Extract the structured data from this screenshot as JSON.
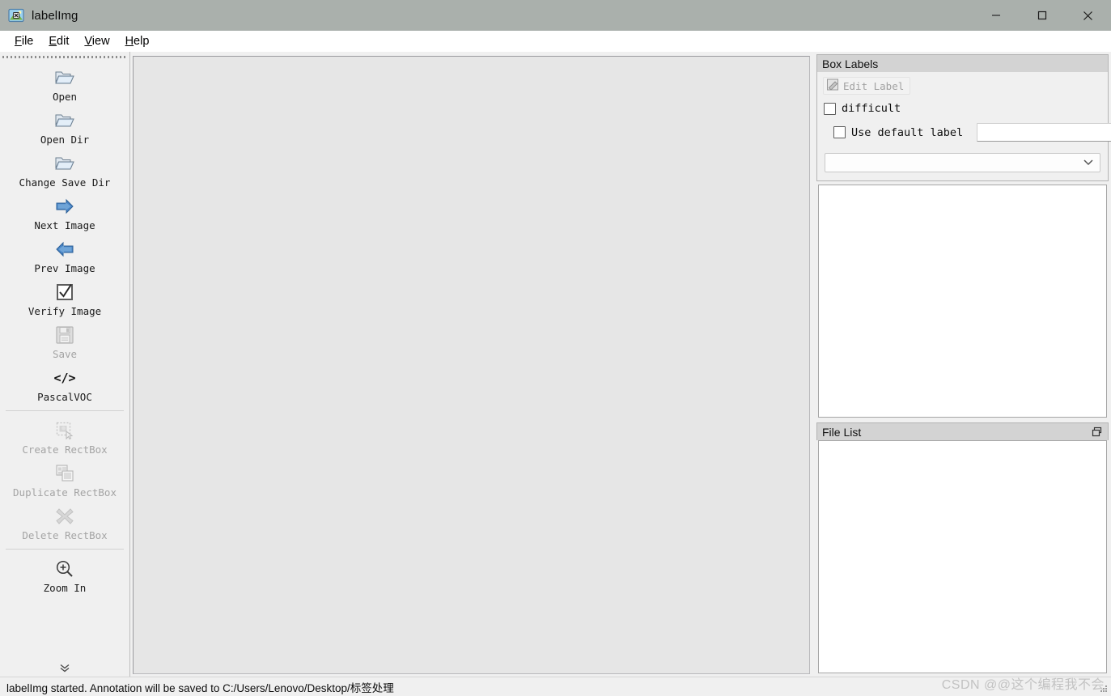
{
  "window": {
    "title": "labelImg",
    "icon": "image-label-icon",
    "minimize_label": "Minimize",
    "maximize_label": "Maximize",
    "close_label": "Close"
  },
  "menubar": {
    "items": [
      {
        "label": "File",
        "mnemonic": "F",
        "rest": "ile"
      },
      {
        "label": "Edit",
        "mnemonic": "E",
        "rest": "dit"
      },
      {
        "label": "View",
        "mnemonic": "V",
        "rest": "iew"
      },
      {
        "label": "Help",
        "mnemonic": "H",
        "rest": "elp"
      }
    ]
  },
  "toolbar": {
    "overflow_indicator": "chevron-double-down-icon",
    "items": [
      {
        "label": "Open",
        "icon": "open-folder-icon",
        "enabled": true,
        "name": "open"
      },
      {
        "label": "Open Dir",
        "icon": "open-folder-icon",
        "enabled": true,
        "name": "open-dir"
      },
      {
        "label": "Change Save Dir",
        "icon": "open-folder-icon",
        "enabled": true,
        "name": "change-save-dir"
      },
      {
        "label": "Next Image",
        "icon": "arrow-right-icon",
        "enabled": true,
        "name": "next-image"
      },
      {
        "label": "Prev Image",
        "icon": "arrow-left-icon",
        "enabled": true,
        "name": "prev-image"
      },
      {
        "label": "Verify Image",
        "icon": "checkbox-check-icon",
        "enabled": true,
        "name": "verify-image"
      },
      {
        "label": "Save",
        "icon": "floppy-save-icon",
        "enabled": false,
        "name": "save"
      },
      {
        "label": "PascalVOC",
        "icon": "code-tags-icon",
        "enabled": true,
        "name": "format-pascalvoc"
      },
      {
        "label": "Create RectBox",
        "icon": "create-rect-icon",
        "enabled": false,
        "name": "create-rectbox"
      },
      {
        "label": "Duplicate RectBox",
        "icon": "duplicate-rect-icon",
        "enabled": false,
        "name": "duplicate-rectbox"
      },
      {
        "label": "Delete RectBox",
        "icon": "delete-cross-icon",
        "enabled": false,
        "name": "delete-rectbox"
      },
      {
        "label": "Zoom In",
        "icon": "zoom-in-icon",
        "enabled": true,
        "name": "zoom-in"
      }
    ]
  },
  "canvas": {
    "background_color": "#e6e6e6",
    "content": ""
  },
  "box_labels_panel": {
    "title": "Box Labels",
    "edit_label_button": "Edit Label",
    "edit_label_enabled": false,
    "difficult_checkbox": {
      "label": "difficult",
      "checked": false
    },
    "use_default_label_checkbox": {
      "label": "Use default label",
      "checked": false
    },
    "default_label_input": {
      "value": "",
      "placeholder": ""
    },
    "label_combo": {
      "value": "",
      "options": []
    },
    "labels_list": []
  },
  "file_list_panel": {
    "title": "File List",
    "float_button": "undock-icon",
    "files": []
  },
  "statusbar": {
    "message": "labelImg started. Annotation will be saved to C:/Users/Lenovo/Desktop/标签处理"
  },
  "watermark": {
    "text": "CSDN @@这个编程我不会"
  },
  "colors": {
    "titlebar": "#aab0ac",
    "chrome": "#f0f0f0",
    "canvas": "#e6e6e6",
    "dock_header": "#d3d3d3",
    "disabled_text": "#a4a4a4"
  }
}
